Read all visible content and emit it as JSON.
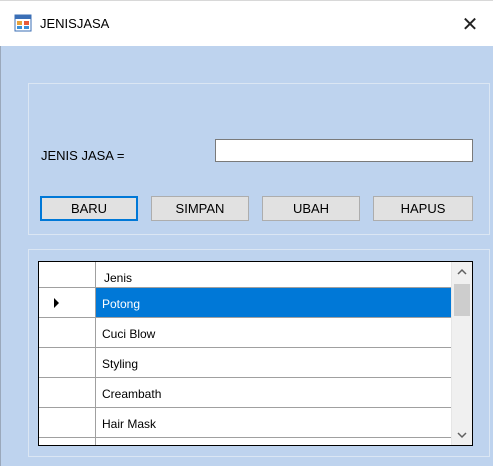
{
  "window": {
    "title": "JENISJASA",
    "close_glyph": "✕",
    "icon": "form-icon"
  },
  "form": {
    "label": "JENIS JASA =",
    "input_value": "",
    "input_placeholder": ""
  },
  "buttons": {
    "baru": "BARU",
    "simpan": "SIMPAN",
    "ubah": "UBAH",
    "hapus": "HAPUS"
  },
  "grid": {
    "column_header": "Jenis",
    "rows": [
      "Potong",
      "Cuci Blow",
      "Styling",
      "Creambath",
      "Hair Mask"
    ],
    "selected_row": 0
  },
  "colors": {
    "client_background": "#bed3ee",
    "selection": "#0078d7",
    "default_button_border": "#0078d7"
  }
}
